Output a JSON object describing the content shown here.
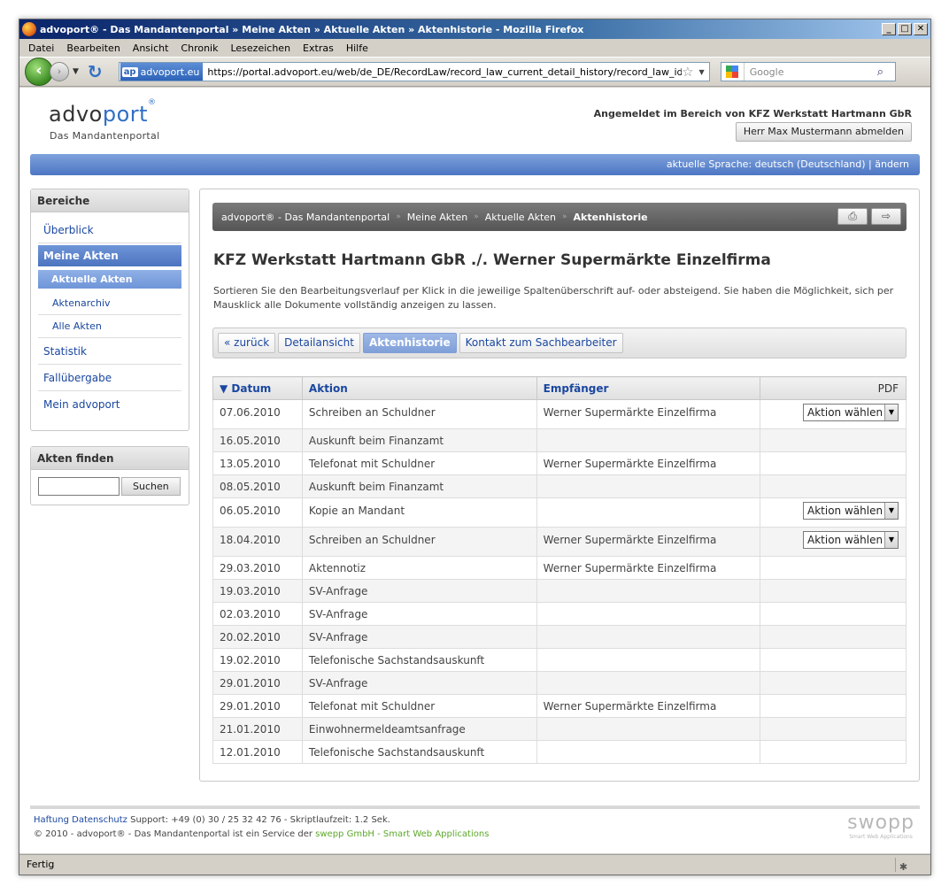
{
  "browser": {
    "title": "advoport® - Das Mandantenportal » Meine Akten » Aktuelle Akten » Aktenhistorie - Mozilla Firefox",
    "menu": [
      "Datei",
      "Bearbeiten",
      "Ansicht",
      "Chronik",
      "Lesezeichen",
      "Extras",
      "Hilfe"
    ],
    "site_identity": "advoport.eu",
    "site_identity_badge": "ap",
    "url": "https://portal.advoport.eu/web/de_DE/RecordLaw/record_law_current_detail_history/record_law_id/40",
    "search_placeholder": "Google",
    "status": "Fertig"
  },
  "header": {
    "logo_part1": "advo",
    "logo_part2": "port",
    "logo_reg": "®",
    "logo_subtitle": "Das Mandantenportal",
    "login_info": "Angemeldet im Bereich von KFZ Werkstatt Hartmann GbR",
    "logout_label": "Herr Max Mustermann abmelden",
    "language": "aktuelle Sprache: deutsch (Deutschland) | ändern"
  },
  "sidebar": {
    "areas_title": "Bereiche",
    "items": {
      "overview": "Überblick",
      "my_files": "Meine Akten",
      "current_files": "Aktuelle Akten",
      "archive": "Aktenarchiv",
      "all_files": "Alle Akten",
      "statistics": "Statistik",
      "handover": "Fallübergabe",
      "my_advoport": "Mein advoport"
    },
    "find_title": "Akten finden",
    "find_button": "Suchen"
  },
  "breadcrumb": {
    "items": [
      "advoport® - Das Mandantenportal",
      "Meine Akten",
      "Aktuelle Akten",
      "Aktenhistorie"
    ]
  },
  "main": {
    "title": "KFZ Werkstatt Hartmann GbR ./. Werner Supermärkte Einzelfirma",
    "intro": "Sortieren Sie den Bearbeitungsverlauf per Klick in die jeweilige Spaltenüberschrift auf- oder absteigend. Sie haben die Möglichkeit, sich per Mausklick alle Dokumente vollständig anzeigen zu lassen.",
    "tabs": {
      "back": "« zurück",
      "detail": "Detailansicht",
      "history": "Aktenhistorie",
      "contact": "Kontakt zum Sachbearbeiter"
    }
  },
  "table": {
    "headers": {
      "date": "▼ Datum",
      "action": "Aktion",
      "recipient": "Empfänger",
      "pdf": "PDF"
    },
    "select_label": "Aktion wählen",
    "rows": [
      {
        "date": "07.06.2010",
        "action": "Schreiben an Schuldner",
        "recipient": "Werner Supermärkte Einzelfirma",
        "pdf": true
      },
      {
        "date": "16.05.2010",
        "action": "Auskunft beim Finanzamt",
        "recipient": "",
        "pdf": false
      },
      {
        "date": "13.05.2010",
        "action": "Telefonat mit Schuldner",
        "recipient": "Werner Supermärkte Einzelfirma",
        "pdf": false
      },
      {
        "date": "08.05.2010",
        "action": "Auskunft beim Finanzamt",
        "recipient": "",
        "pdf": false
      },
      {
        "date": "06.05.2010",
        "action": "Kopie an Mandant",
        "recipient": "",
        "pdf": true
      },
      {
        "date": "18.04.2010",
        "action": "Schreiben an Schuldner",
        "recipient": "Werner Supermärkte Einzelfirma",
        "pdf": true
      },
      {
        "date": "29.03.2010",
        "action": "Aktennotiz",
        "recipient": "Werner Supermärkte Einzelfirma",
        "pdf": false
      },
      {
        "date": "19.03.2010",
        "action": "SV-Anfrage",
        "recipient": "",
        "pdf": false
      },
      {
        "date": "02.03.2010",
        "action": "SV-Anfrage",
        "recipient": "",
        "pdf": false
      },
      {
        "date": "20.02.2010",
        "action": "SV-Anfrage",
        "recipient": "",
        "pdf": false
      },
      {
        "date": "19.02.2010",
        "action": "Telefonische Sachstandsauskunft",
        "recipient": "",
        "pdf": false
      },
      {
        "date": "29.01.2010",
        "action": "SV-Anfrage",
        "recipient": "",
        "pdf": false
      },
      {
        "date": "29.01.2010",
        "action": "Telefonat mit Schuldner",
        "recipient": "Werner Supermärkte Einzelfirma",
        "pdf": false
      },
      {
        "date": "21.01.2010",
        "action": "Einwohnermeldeamtsanfrage",
        "recipient": "",
        "pdf": false
      },
      {
        "date": "12.01.2010",
        "action": "Telefonische Sachstandsauskunft",
        "recipient": "",
        "pdf": false
      }
    ]
  },
  "footer": {
    "liability": "Haftung",
    "privacy": "Datenschutz",
    "support": "Support: +49 (0) 30 / 25 32 42 76 - Skriptlaufzeit: 1.2 Sek.",
    "copyright": "© 2010 - advoport® - Das Mandantenportal ist ein Service der",
    "company": "swepp GmbH - Smart Web Applications",
    "brand": "swopp",
    "brand_tagline": "Smart Web Applications"
  }
}
